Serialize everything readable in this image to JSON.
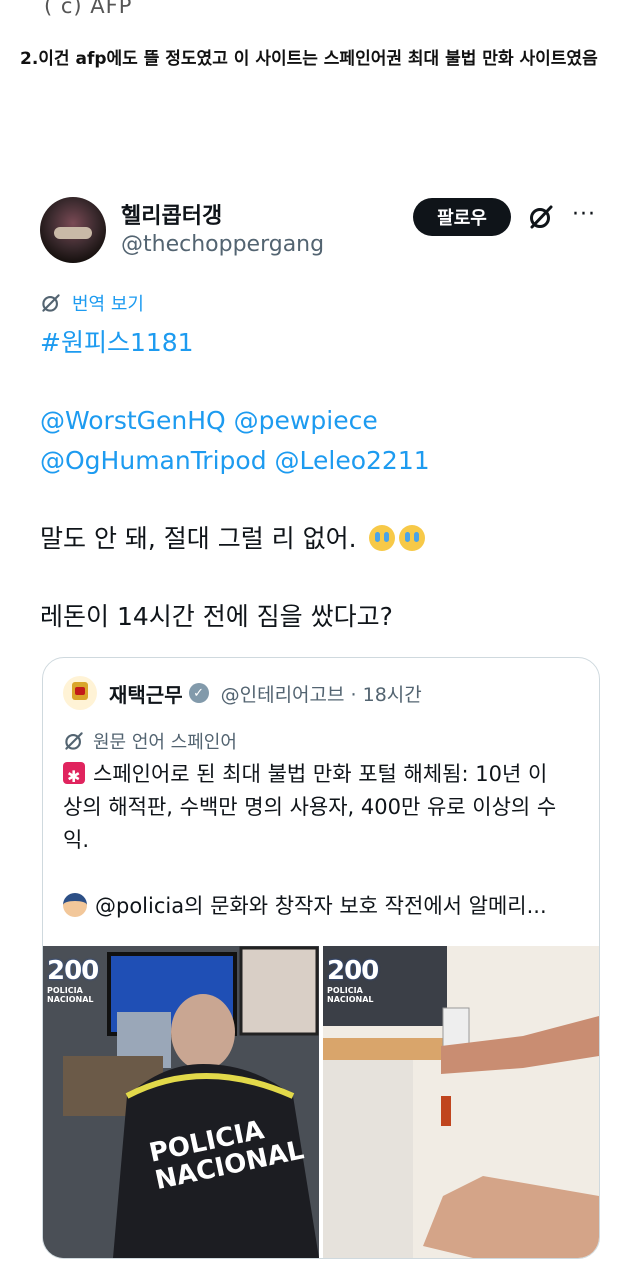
{
  "caption_top": "( c) AFP",
  "post_title": "2.이건 afp에도 뜰 정도였고 이 사이트는 스페인어권 최대 불법 만화 사이트였음",
  "tweet": {
    "display_name": "헬리콥터갱",
    "handle": "@thechoppergang",
    "follow_label": "팔로우",
    "more_icon": "···",
    "translate_label": "번역 보기",
    "hashtag": "#원피스1181",
    "mentions_line1": "@WorstGenHQ @pewpiece",
    "mentions_line2": "@OgHumanTripod @Leleo2211",
    "body_line1": "말도 안 돼, 절대 그럴 리 없어.",
    "body_line2": "레돈이 14시간 전에 짐을 쌌다고?",
    "colors": {
      "link": "#1d9bf0",
      "follow_bg": "#0f1419"
    }
  },
  "quote": {
    "name": "재택근무",
    "handle_time": "@인테리어고브 · 18시간",
    "original_language": "원문 언어 스페인어",
    "line1": "스페인어로 된 최대 불법 만화 포털 해체됨: 10년 이",
    "line2": "상의 해적판, 수백만 명의 사용자, 400만 유로 이상의 수",
    "line3": "익.",
    "line4": "@policia의 문화와 창작자 보호 작전에서 알메리...",
    "photo_left": {
      "wm_big": "200",
      "wm_small1": "POLICIA",
      "wm_small2": "NACIONAL",
      "vest1": "POLICIA",
      "vest2": "NACIONAL"
    },
    "photo_right": {
      "wm_big": "200",
      "wm_small1": "POLICIA",
      "wm_small2": "NACIONAL"
    }
  }
}
